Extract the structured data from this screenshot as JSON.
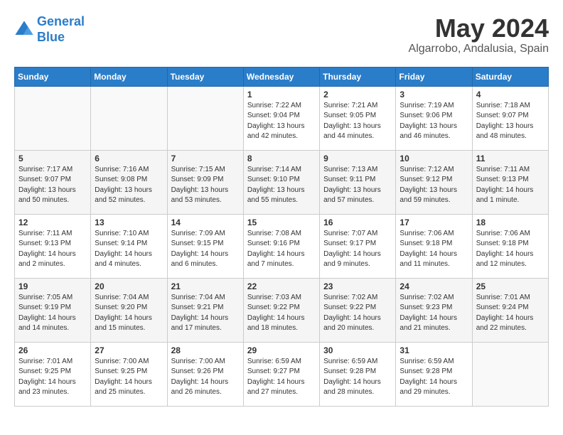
{
  "logo": {
    "line1": "General",
    "line2": "Blue"
  },
  "title": "May 2024",
  "location": "Algarrobo, Andalusia, Spain",
  "weekdays": [
    "Sunday",
    "Monday",
    "Tuesday",
    "Wednesday",
    "Thursday",
    "Friday",
    "Saturday"
  ],
  "weeks": [
    [
      {
        "day": "",
        "info": ""
      },
      {
        "day": "",
        "info": ""
      },
      {
        "day": "",
        "info": ""
      },
      {
        "day": "1",
        "info": "Sunrise: 7:22 AM\nSunset: 9:04 PM\nDaylight: 13 hours\nand 42 minutes."
      },
      {
        "day": "2",
        "info": "Sunrise: 7:21 AM\nSunset: 9:05 PM\nDaylight: 13 hours\nand 44 minutes."
      },
      {
        "day": "3",
        "info": "Sunrise: 7:19 AM\nSunset: 9:06 PM\nDaylight: 13 hours\nand 46 minutes."
      },
      {
        "day": "4",
        "info": "Sunrise: 7:18 AM\nSunset: 9:07 PM\nDaylight: 13 hours\nand 48 minutes."
      }
    ],
    [
      {
        "day": "5",
        "info": "Sunrise: 7:17 AM\nSunset: 9:07 PM\nDaylight: 13 hours\nand 50 minutes."
      },
      {
        "day": "6",
        "info": "Sunrise: 7:16 AM\nSunset: 9:08 PM\nDaylight: 13 hours\nand 52 minutes."
      },
      {
        "day": "7",
        "info": "Sunrise: 7:15 AM\nSunset: 9:09 PM\nDaylight: 13 hours\nand 53 minutes."
      },
      {
        "day": "8",
        "info": "Sunrise: 7:14 AM\nSunset: 9:10 PM\nDaylight: 13 hours\nand 55 minutes."
      },
      {
        "day": "9",
        "info": "Sunrise: 7:13 AM\nSunset: 9:11 PM\nDaylight: 13 hours\nand 57 minutes."
      },
      {
        "day": "10",
        "info": "Sunrise: 7:12 AM\nSunset: 9:12 PM\nDaylight: 13 hours\nand 59 minutes."
      },
      {
        "day": "11",
        "info": "Sunrise: 7:11 AM\nSunset: 9:13 PM\nDaylight: 14 hours\nand 1 minute."
      }
    ],
    [
      {
        "day": "12",
        "info": "Sunrise: 7:11 AM\nSunset: 9:13 PM\nDaylight: 14 hours\nand 2 minutes."
      },
      {
        "day": "13",
        "info": "Sunrise: 7:10 AM\nSunset: 9:14 PM\nDaylight: 14 hours\nand 4 minutes."
      },
      {
        "day": "14",
        "info": "Sunrise: 7:09 AM\nSunset: 9:15 PM\nDaylight: 14 hours\nand 6 minutes."
      },
      {
        "day": "15",
        "info": "Sunrise: 7:08 AM\nSunset: 9:16 PM\nDaylight: 14 hours\nand 7 minutes."
      },
      {
        "day": "16",
        "info": "Sunrise: 7:07 AM\nSunset: 9:17 PM\nDaylight: 14 hours\nand 9 minutes."
      },
      {
        "day": "17",
        "info": "Sunrise: 7:06 AM\nSunset: 9:18 PM\nDaylight: 14 hours\nand 11 minutes."
      },
      {
        "day": "18",
        "info": "Sunrise: 7:06 AM\nSunset: 9:18 PM\nDaylight: 14 hours\nand 12 minutes."
      }
    ],
    [
      {
        "day": "19",
        "info": "Sunrise: 7:05 AM\nSunset: 9:19 PM\nDaylight: 14 hours\nand 14 minutes."
      },
      {
        "day": "20",
        "info": "Sunrise: 7:04 AM\nSunset: 9:20 PM\nDaylight: 14 hours\nand 15 minutes."
      },
      {
        "day": "21",
        "info": "Sunrise: 7:04 AM\nSunset: 9:21 PM\nDaylight: 14 hours\nand 17 minutes."
      },
      {
        "day": "22",
        "info": "Sunrise: 7:03 AM\nSunset: 9:22 PM\nDaylight: 14 hours\nand 18 minutes."
      },
      {
        "day": "23",
        "info": "Sunrise: 7:02 AM\nSunset: 9:22 PM\nDaylight: 14 hours\nand 20 minutes."
      },
      {
        "day": "24",
        "info": "Sunrise: 7:02 AM\nSunset: 9:23 PM\nDaylight: 14 hours\nand 21 minutes."
      },
      {
        "day": "25",
        "info": "Sunrise: 7:01 AM\nSunset: 9:24 PM\nDaylight: 14 hours\nand 22 minutes."
      }
    ],
    [
      {
        "day": "26",
        "info": "Sunrise: 7:01 AM\nSunset: 9:25 PM\nDaylight: 14 hours\nand 23 minutes."
      },
      {
        "day": "27",
        "info": "Sunrise: 7:00 AM\nSunset: 9:25 PM\nDaylight: 14 hours\nand 25 minutes."
      },
      {
        "day": "28",
        "info": "Sunrise: 7:00 AM\nSunset: 9:26 PM\nDaylight: 14 hours\nand 26 minutes."
      },
      {
        "day": "29",
        "info": "Sunrise: 6:59 AM\nSunset: 9:27 PM\nDaylight: 14 hours\nand 27 minutes."
      },
      {
        "day": "30",
        "info": "Sunrise: 6:59 AM\nSunset: 9:28 PM\nDaylight: 14 hours\nand 28 minutes."
      },
      {
        "day": "31",
        "info": "Sunrise: 6:59 AM\nSunset: 9:28 PM\nDaylight: 14 hours\nand 29 minutes."
      },
      {
        "day": "",
        "info": ""
      }
    ]
  ]
}
